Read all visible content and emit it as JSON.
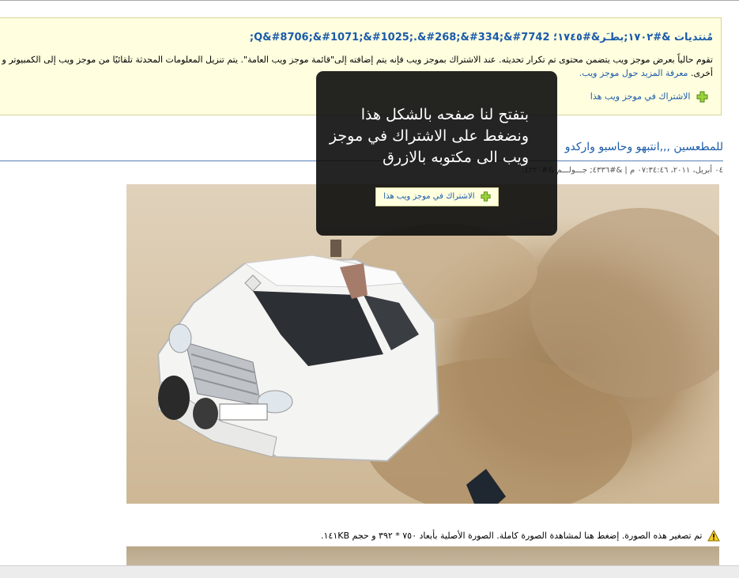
{
  "feed": {
    "title": "مُنتديات &#١٧٠٢;بطـَر&#١٧٤٥؛ Q&#8706;&#1071;&#1025;.&#268;&#334;&#7742;",
    "description": "تقوم حالياً بعرض موجز ويب يتضمن محتوى تم تكرار تحديثه. عند الاشتراك بموجز ويب فإنه يتم إضافته إلى\"قائمة موجز ويب العامة\". يتم تنزيل المعلومات المحدثة تلقائيًا من موجز ويب إلى الكمبيوتر و",
    "description_cont": "أخرى.",
    "learn_more": "معرفة المزيد حول موجز ويب.",
    "subscribe_label": "الاشتراك في موجز ويب هذا"
  },
  "article": {
    "title": "للمطعسين ,,,انتبهو وحاسبو واركدو",
    "meta": "٠٤ أبريل، ٢٠١١، ٠٧:٣٤:٤٦ م | &#٤٣٣٦; جـــولـــم &#٤٣٣٠;"
  },
  "tooltip": {
    "message": "بتفتح لنا صفحه بالشكل هذا ونضغط على الاشتراك في موجز ويب الى مكتوبه بالازرق",
    "button_label": "الاشتراك في موجز ويب هذا"
  },
  "notice": {
    "resize_text": "تم تصغير هذه الصورة. إضغط هنا لمشاهدة الصورة كاملة. الصورة الأصلية بأبعاد ٧٥٠ * ٣٩٢ و حجم ١٤١KB."
  },
  "colors": {
    "link": "#1a5baa",
    "feed_bg": "#fffedf",
    "tooltip_bg": "#0c0c0c"
  },
  "icons": [
    "subscribe-plus-icon",
    "warning-icon"
  ]
}
